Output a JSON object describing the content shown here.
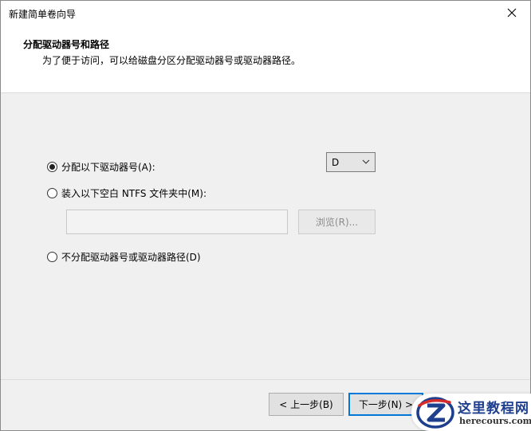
{
  "window": {
    "title": "新建简单卷向导"
  },
  "header": {
    "title": "分配驱动器号和路径",
    "subtitle": "为了便于访问，可以给磁盘分区分配驱动器号或驱动器路径。"
  },
  "options": {
    "assign_letter": {
      "label": "分配以下驱动器号(A):",
      "checked": true
    },
    "mount_folder": {
      "label": "装入以下空白 NTFS 文件夹中(M):",
      "checked": false
    },
    "no_assign": {
      "label": "不分配驱动器号或驱动器路径(D)",
      "checked": false
    }
  },
  "drive_select": {
    "value": "D"
  },
  "folder_path": {
    "value": "",
    "placeholder": ""
  },
  "browse_button": {
    "label": "浏览(R)..."
  },
  "footer": {
    "back_label": "< 上一步(B)",
    "next_label": "下一步(N) >"
  },
  "watermark": {
    "title": "这里教程网",
    "url": "herecours.com"
  },
  "colors": {
    "accent": "#0078d7",
    "body_bg": "#f0f0f0",
    "disabled_text": "#8c8c8c",
    "watermark_blue": "#1e3e8e",
    "watermark_red": "#d62b2b"
  }
}
